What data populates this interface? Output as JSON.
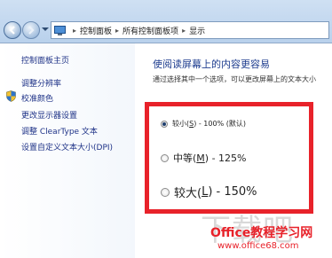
{
  "breadcrumb": {
    "items": [
      "控制面板",
      "所有控制面板项",
      "显示"
    ]
  },
  "sidebar": {
    "items": [
      {
        "label": "控制面板主页"
      },
      {
        "label": "调整分辨率"
      },
      {
        "label": "校准颜色"
      },
      {
        "label": "更改显示器设置"
      },
      {
        "label": "调整 ClearType 文本"
      },
      {
        "label": "设置自定义文本大小(DPI)"
      }
    ]
  },
  "main": {
    "heading": "使阅读屏幕上的内容更容易",
    "description": "通过选择其中一个选项，可以更改屏幕上的文本大小",
    "options": [
      {
        "pre": "较小(",
        "key": "S",
        "post": ") - 100% (默认)",
        "selected": true
      },
      {
        "pre": "中等(",
        "key": "M",
        "post": ") - 125%",
        "selected": false
      },
      {
        "pre": "较大(",
        "key": "L",
        "post": ") - 150%",
        "selected": false
      }
    ]
  },
  "watermark": {
    "line1": "下载吧",
    "line2": "Office教程学习网",
    "line3": "www.office68.com"
  },
  "colors": {
    "highlight_box": "#e8222a",
    "link": "#1e3287"
  }
}
